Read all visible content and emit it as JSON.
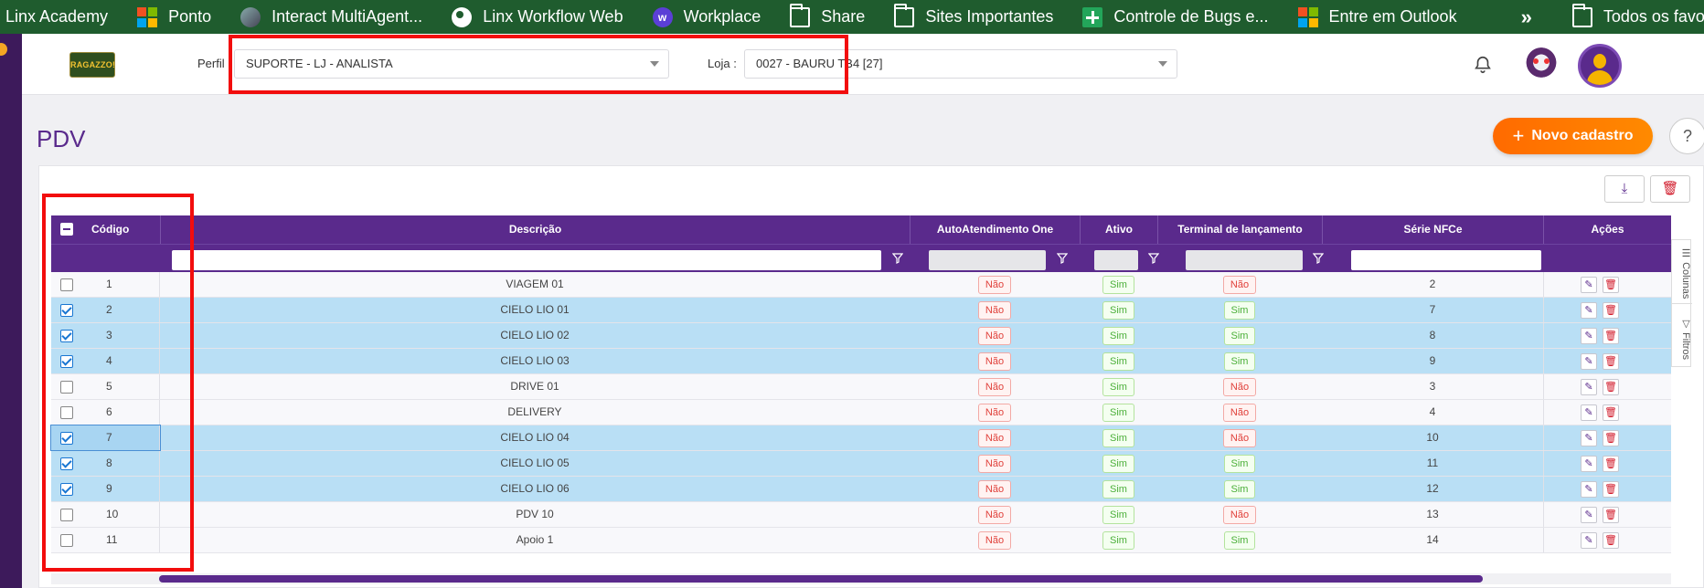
{
  "bookmarks": [
    {
      "label": "Linx Academy",
      "icon": "none"
    },
    {
      "label": "Ponto",
      "icon": "microsoft-icon"
    },
    {
      "label": "Interact MultiAgent...",
      "icon": "agent-icon"
    },
    {
      "label": "Linx Workflow Web",
      "icon": "globe-icon"
    },
    {
      "label": "Workplace",
      "icon": "workplace-icon"
    },
    {
      "label": "Share",
      "icon": "folder-icon"
    },
    {
      "label": "Sites Importantes",
      "icon": "folder-icon"
    },
    {
      "label": "Controle de Bugs e...",
      "icon": "plus-icon"
    },
    {
      "label": "Entre em Outlook",
      "icon": "microsoft-icon"
    }
  ],
  "bookmarks_more": "»",
  "bookmarks_all": "Todos os favoritos",
  "header": {
    "logo_text": "RAGAZZO!",
    "perfil_label": "Perfil :",
    "perfil_value": "SUPORTE - LJ - ANALISTA",
    "loja_label": "Loja :",
    "loja_value": "0027 - BAURU TB4 [27]"
  },
  "page": {
    "title": "PDV",
    "new_button": "Novo cadastro",
    "help": "?"
  },
  "grid": {
    "columns": {
      "codigo": "Código",
      "descricao": "Descrição",
      "auto": "AutoAtendimento One",
      "ativo": "Ativo",
      "terminal": "Terminal de lançamento",
      "serie": "Série NFCe",
      "acoes": "Ações"
    },
    "rows": [
      {
        "codigo": "1",
        "descricao": "VIAGEM 01",
        "auto": "Não",
        "ativo": "Sim",
        "terminal": "Não",
        "serie": "2",
        "checked": false
      },
      {
        "codigo": "2",
        "descricao": "CIELO LIO 01",
        "auto": "Não",
        "ativo": "Sim",
        "terminal": "Sim",
        "serie": "7",
        "checked": true
      },
      {
        "codigo": "3",
        "descricao": "CIELO LIO 02",
        "auto": "Não",
        "ativo": "Sim",
        "terminal": "Sim",
        "serie": "8",
        "checked": true
      },
      {
        "codigo": "4",
        "descricao": "CIELO LIO 03",
        "auto": "Não",
        "ativo": "Sim",
        "terminal": "Sim",
        "serie": "9",
        "checked": true
      },
      {
        "codigo": "5",
        "descricao": "DRIVE 01",
        "auto": "Não",
        "ativo": "Sim",
        "terminal": "Não",
        "serie": "3",
        "checked": false
      },
      {
        "codigo": "6",
        "descricao": "DELIVERY",
        "auto": "Não",
        "ativo": "Sim",
        "terminal": "Não",
        "serie": "4",
        "checked": false
      },
      {
        "codigo": "7",
        "descricao": "CIELO LIO 04",
        "auto": "Não",
        "ativo": "Sim",
        "terminal": "Não",
        "serie": "10",
        "checked": true
      },
      {
        "codigo": "8",
        "descricao": "CIELO LIO 05",
        "auto": "Não",
        "ativo": "Sim",
        "terminal": "Sim",
        "serie": "11",
        "checked": true
      },
      {
        "codigo": "9",
        "descricao": "CIELO LIO 06",
        "auto": "Não",
        "ativo": "Sim",
        "terminal": "Sim",
        "serie": "12",
        "checked": true
      },
      {
        "codigo": "10",
        "descricao": "PDV 10",
        "auto": "Não",
        "ativo": "Sim",
        "terminal": "Não",
        "serie": "13",
        "checked": false
      },
      {
        "codigo": "11",
        "descricao": "Apoio 1",
        "auto": "Não",
        "ativo": "Sim",
        "terminal": "Sim",
        "serie": "14",
        "checked": false
      }
    ]
  },
  "side_panel": {
    "colunas": "Colunas",
    "filtros": "Filtros"
  },
  "colors": {
    "accent": "#5a2a8c",
    "bookmark_bar": "#1f5c2e",
    "primary_button": "#ff7a00",
    "selected_row": "#b9dff5",
    "highlight_box": "#f20d0d"
  }
}
